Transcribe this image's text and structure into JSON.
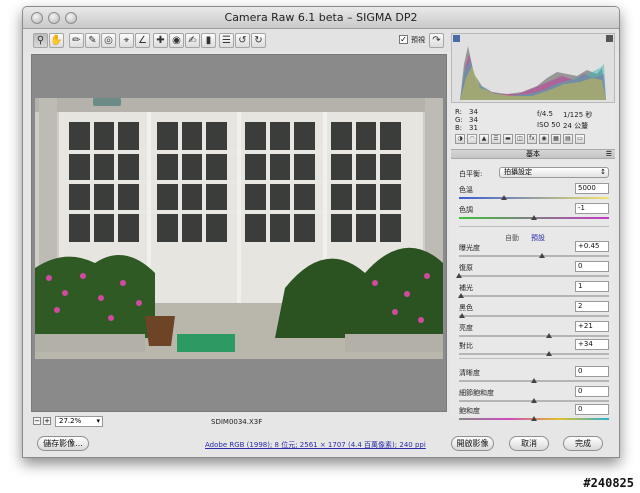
{
  "window": {
    "title": "Camera Raw 6.1 beta  –  SIGMA DP2"
  },
  "toolbar": {
    "tools": [
      "zoom-tool",
      "hand-tool",
      "white-balance-tool",
      "color-sampler-tool",
      "target-adjustment-tool",
      "crop-tool",
      "straighten-tool",
      "spot-removal-tool",
      "red-eye-tool",
      "adjustment-brush-tool",
      "graduated-filter-tool",
      "preferences-tool",
      "rotate-ccw-tool",
      "rotate-cw-tool"
    ],
    "preview_label": "預視"
  },
  "status": {
    "zoom": "27.2%",
    "filename": "SDIM0034.X3F",
    "workflow_link": "Adobe RGB (1998); 8 位元; 2561 × 1707 (4.4 百萬像素); 240 ppi"
  },
  "buttons": {
    "save": "儲存影像...",
    "open": "開啟影像",
    "cancel": "取消",
    "done": "完成"
  },
  "info": {
    "r_label": "R:",
    "r": "34",
    "g_label": "G:",
    "g": "34",
    "b_label": "B:",
    "b": "31",
    "aperture": "f/4.5",
    "shutter": "1/125 秒",
    "iso": "ISO 50",
    "focal": "24 公釐"
  },
  "panel": {
    "section_title": "基本",
    "wb_label": "白平衡:",
    "wb_value": "拍攝設定",
    "auto_label": "自動",
    "default_label": "預設",
    "sliders": [
      {
        "label": "色溫",
        "value": "5000",
        "pos": 0.3
      },
      {
        "label": "色調",
        "value": "-1",
        "pos": 0.5
      },
      {
        "label": "曝光度",
        "value": "+0.45",
        "pos": 0.55
      },
      {
        "label": "復原",
        "value": "0",
        "pos": 0.0
      },
      {
        "label": "補光",
        "value": "1",
        "pos": 0.01
      },
      {
        "label": "黑色",
        "value": "2",
        "pos": 0.02
      },
      {
        "label": "亮度",
        "value": "+21",
        "pos": 0.6
      },
      {
        "label": "對比",
        "value": "+34",
        "pos": 0.6
      },
      {
        "label": "清晰度",
        "value": "0",
        "pos": 0.5
      },
      {
        "label": "細節飽和度",
        "value": "0",
        "pos": 0.5
      },
      {
        "label": "飽和度",
        "value": "0",
        "pos": 0.5
      }
    ]
  },
  "watermark": "#240825"
}
